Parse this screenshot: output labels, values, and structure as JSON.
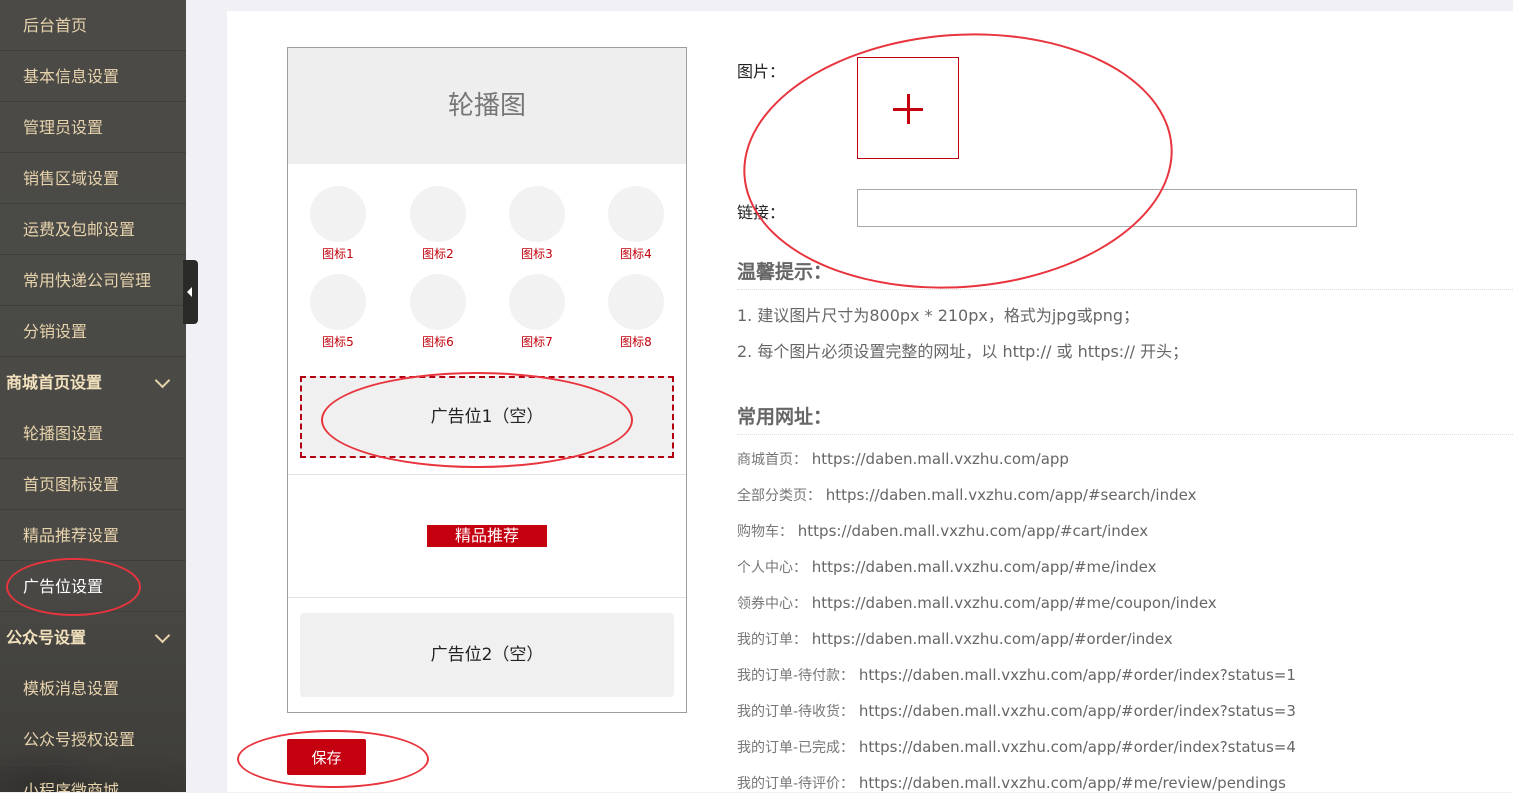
{
  "sidebar": {
    "items": [
      {
        "label": "后台首页"
      },
      {
        "label": "基本信息设置"
      },
      {
        "label": "管理员设置"
      },
      {
        "label": "销售区域设置"
      },
      {
        "label": "运费及包邮设置"
      },
      {
        "label": "常用快递公司管理"
      },
      {
        "label": "分销设置"
      }
    ],
    "group_home": "商城首页设置",
    "home_items": [
      {
        "label": "轮播图设置"
      },
      {
        "label": "首页图标设置"
      },
      {
        "label": "精品推荐设置"
      },
      {
        "label": "广告位设置"
      }
    ],
    "group_wechat": "公众号设置",
    "wechat_items": [
      {
        "label": "模板消息设置"
      },
      {
        "label": "公众号授权设置"
      },
      {
        "label": "小程序微商城"
      }
    ]
  },
  "preview": {
    "banner_label": "轮播图",
    "icons": [
      "图标1",
      "图标2",
      "图标3",
      "图标4",
      "图标5",
      "图标6",
      "图标7",
      "图标8"
    ],
    "ad1_label": "广告位1（空）",
    "recommend_label": "精品推荐",
    "ad2_label": "广告位2（空）"
  },
  "save_label": "保存",
  "form": {
    "image_label": "图片：",
    "upload_plus": "+",
    "link_label": "链接：",
    "link_value": ""
  },
  "tips": {
    "title": "温馨提示：",
    "lines": [
      "1. 建议图片尺寸为800px * 210px，格式为jpg或png；",
      "2. 每个图片必须设置完整的网址，以 http:// 或 https:// 开头；"
    ]
  },
  "urls": {
    "title": "常用网址：",
    "rows": [
      {
        "key": "商城首页：",
        "url": "https://daben.mall.vxzhu.com/app"
      },
      {
        "key": "全部分类页：",
        "url": "https://daben.mall.vxzhu.com/app/#search/index"
      },
      {
        "key": "购物车：",
        "url": "https://daben.mall.vxzhu.com/app/#cart/index"
      },
      {
        "key": "个人中心：",
        "url": "https://daben.mall.vxzhu.com/app/#me/index"
      },
      {
        "key": "领券中心：",
        "url": "https://daben.mall.vxzhu.com/app/#me/coupon/index"
      },
      {
        "key": "我的订单：",
        "url": "https://daben.mall.vxzhu.com/app/#order/index"
      },
      {
        "key": "我的订单-待付款：",
        "url": "https://daben.mall.vxzhu.com/app/#order/index?status=1"
      },
      {
        "key": "我的订单-待收货：",
        "url": "https://daben.mall.vxzhu.com/app/#order/index?status=3"
      },
      {
        "key": "我的订单-已完成：",
        "url": "https://daben.mall.vxzhu.com/app/#order/index?status=4"
      },
      {
        "key": "我的订单-待评价：",
        "url": "https://daben.mall.vxzhu.com/app/#me/review/pendings"
      }
    ]
  },
  "colors": {
    "accent": "#c40010",
    "sidebar_bg": "#4b4a47",
    "sidebar_text": "#e7d3ac",
    "annotation": "#e8343d"
  }
}
